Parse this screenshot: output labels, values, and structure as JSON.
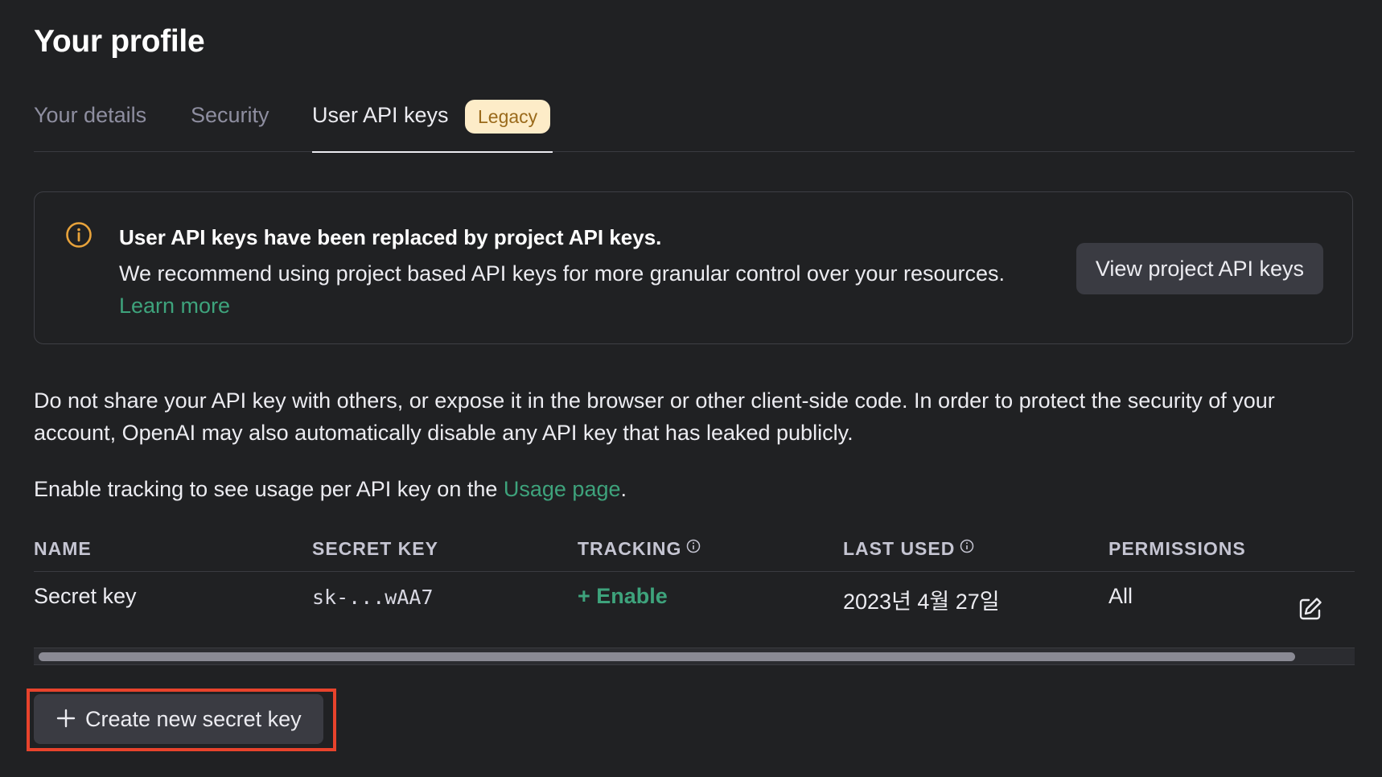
{
  "page_title": "Your profile",
  "tabs": [
    {
      "label": "Your details"
    },
    {
      "label": "Security"
    },
    {
      "label": "User API keys",
      "badge": "Legacy",
      "active": true
    }
  ],
  "notice": {
    "icon": "info-circle-icon",
    "title": "User API keys have been replaced by project API keys.",
    "body": "We recommend using project based API keys for more granular control over your resources.",
    "link": "Learn more",
    "button": "View project API keys"
  },
  "warning_text": "Do not share your API key with others, or expose it in the browser or other client-side code. In order to protect the security of your account, OpenAI may also automatically disable any API key that has leaked publicly.",
  "tracking_text": {
    "prefix": "Enable tracking to see usage per API key on the ",
    "link": "Usage page",
    "suffix": "."
  },
  "table": {
    "columns": [
      "NAME",
      "SECRET KEY",
      "TRACKING",
      "LAST USED",
      "PERMISSIONS"
    ],
    "rows": [
      {
        "name": "Secret key",
        "secret_key": "sk-...wAA7",
        "tracking": "+ Enable",
        "last_used": "2023년 4월 27일",
        "permissions": "All"
      }
    ]
  },
  "create_button": "Create new secret key",
  "colors": {
    "background": "#202123",
    "accent_green": "#3ea37c",
    "badge_bg": "#fdecc8",
    "badge_text": "#9a6a1b",
    "info_icon": "#e8a33b",
    "highlight_outline": "#e8432c"
  }
}
